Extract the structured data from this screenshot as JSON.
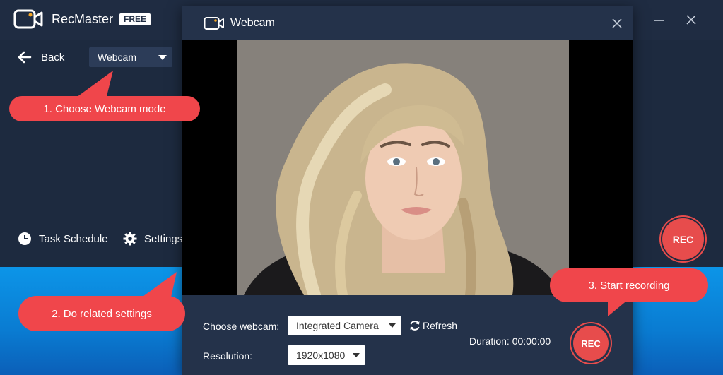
{
  "app": {
    "title": "RecMaster",
    "badge": "FREE",
    "back_label": "Back",
    "mode_value": "Webcam",
    "task_schedule_label": "Task Schedule",
    "settings_label": "Settings",
    "rec_label": "REC"
  },
  "dialog": {
    "title": "Webcam",
    "choose_webcam_label": "Choose webcam:",
    "webcam_value": "Integrated Camera",
    "refresh_label": "Refresh",
    "resolution_label": "Resolution:",
    "resolution_value": "1920x1080",
    "duration_text": "Duration: 00:00:00",
    "rec_label": "REC"
  },
  "callouts": {
    "step1": "1. Choose Webcam mode",
    "step2": "2. Do related settings",
    "step3": "3. Start recording"
  },
  "colors": {
    "accent": "#f0464b",
    "window_bg": "#1d2a3f",
    "dialog_bg": "#24324a",
    "logo_dot": "#f5a623",
    "desktop": "#0c95e8"
  },
  "icons": {
    "logo": "camera-icon",
    "back": "arrow-left-icon",
    "task_schedule": "clock-icon",
    "settings": "gear-icon",
    "refresh": "refresh-icon",
    "minimize": "minimize-icon",
    "close": "close-icon"
  }
}
